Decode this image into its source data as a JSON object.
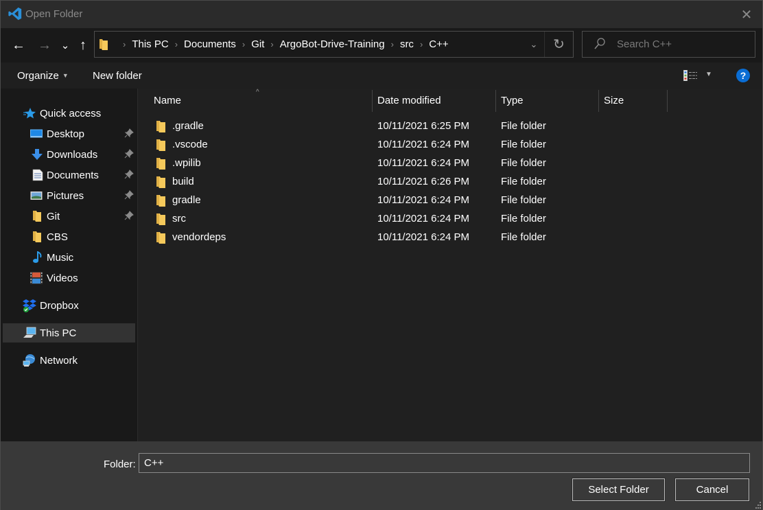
{
  "window": {
    "title": "Open Folder",
    "close_label": "✕"
  },
  "navigation": {
    "back_glyph": "←",
    "forward_glyph": "→",
    "recent_glyph": "⌄",
    "up_glyph": "↑",
    "breadcrumbs": [
      "This PC",
      "Documents",
      "Git",
      "ArgoBot-Drive-Training",
      "src",
      "C++"
    ],
    "breadcrumb_separator": "›",
    "dropdown_glyph": "⌄",
    "refresh_glyph": "↻",
    "search_placeholder": "Search C++"
  },
  "toolbar": {
    "organize_label": "Organize",
    "new_folder_label": "New folder",
    "caret_glyph": "▼",
    "help_label": "?"
  },
  "sidebar": {
    "items": [
      {
        "label": "Quick access",
        "icon": "star-icon",
        "pinned": false,
        "selected": false
      },
      {
        "label": "Desktop",
        "icon": "desktop-icon",
        "pinned": true,
        "selected": false
      },
      {
        "label": "Downloads",
        "icon": "download-arrow-icon",
        "pinned": true,
        "selected": false
      },
      {
        "label": "Documents",
        "icon": "document-icon",
        "pinned": true,
        "selected": false
      },
      {
        "label": "Pictures",
        "icon": "pictures-icon",
        "pinned": true,
        "selected": false
      },
      {
        "label": "Git",
        "icon": "folder-icon",
        "pinned": true,
        "selected": false
      },
      {
        "label": "CBS",
        "icon": "folder-icon",
        "pinned": false,
        "selected": false
      },
      {
        "label": "Music",
        "icon": "music-note-icon",
        "pinned": false,
        "selected": false
      },
      {
        "label": "Videos",
        "icon": "film-icon",
        "pinned": false,
        "selected": false
      },
      {
        "label": "Dropbox",
        "icon": "dropbox-icon",
        "pinned": false,
        "selected": false
      },
      {
        "label": "This PC",
        "icon": "computer-icon",
        "pinned": false,
        "selected": true
      },
      {
        "label": "Network",
        "icon": "network-icon",
        "pinned": false,
        "selected": false
      }
    ]
  },
  "file_list": {
    "columns": [
      "Name",
      "Date modified",
      "Type",
      "Size"
    ],
    "sort_glyph": "^",
    "rows": [
      {
        "name": ".gradle",
        "date": "10/11/2021 6:25 PM",
        "type": "File folder",
        "size": ""
      },
      {
        "name": ".vscode",
        "date": "10/11/2021 6:24 PM",
        "type": "File folder",
        "size": ""
      },
      {
        "name": ".wpilib",
        "date": "10/11/2021 6:24 PM",
        "type": "File folder",
        "size": ""
      },
      {
        "name": "build",
        "date": "10/11/2021 6:26 PM",
        "type": "File folder",
        "size": ""
      },
      {
        "name": "gradle",
        "date": "10/11/2021 6:24 PM",
        "type": "File folder",
        "size": ""
      },
      {
        "name": "src",
        "date": "10/11/2021 6:24 PM",
        "type": "File folder",
        "size": ""
      },
      {
        "name": "vendordeps",
        "date": "10/11/2021 6:24 PM",
        "type": "File folder",
        "size": ""
      }
    ]
  },
  "footer": {
    "folder_label": "Folder:",
    "folder_value": "C++",
    "select_label": "Select Folder",
    "cancel_label": "Cancel"
  },
  "colors": {
    "accent_blue": "#0a6dd4",
    "folder_yellow": "#f5c95b",
    "selected_bg": "#333333"
  }
}
